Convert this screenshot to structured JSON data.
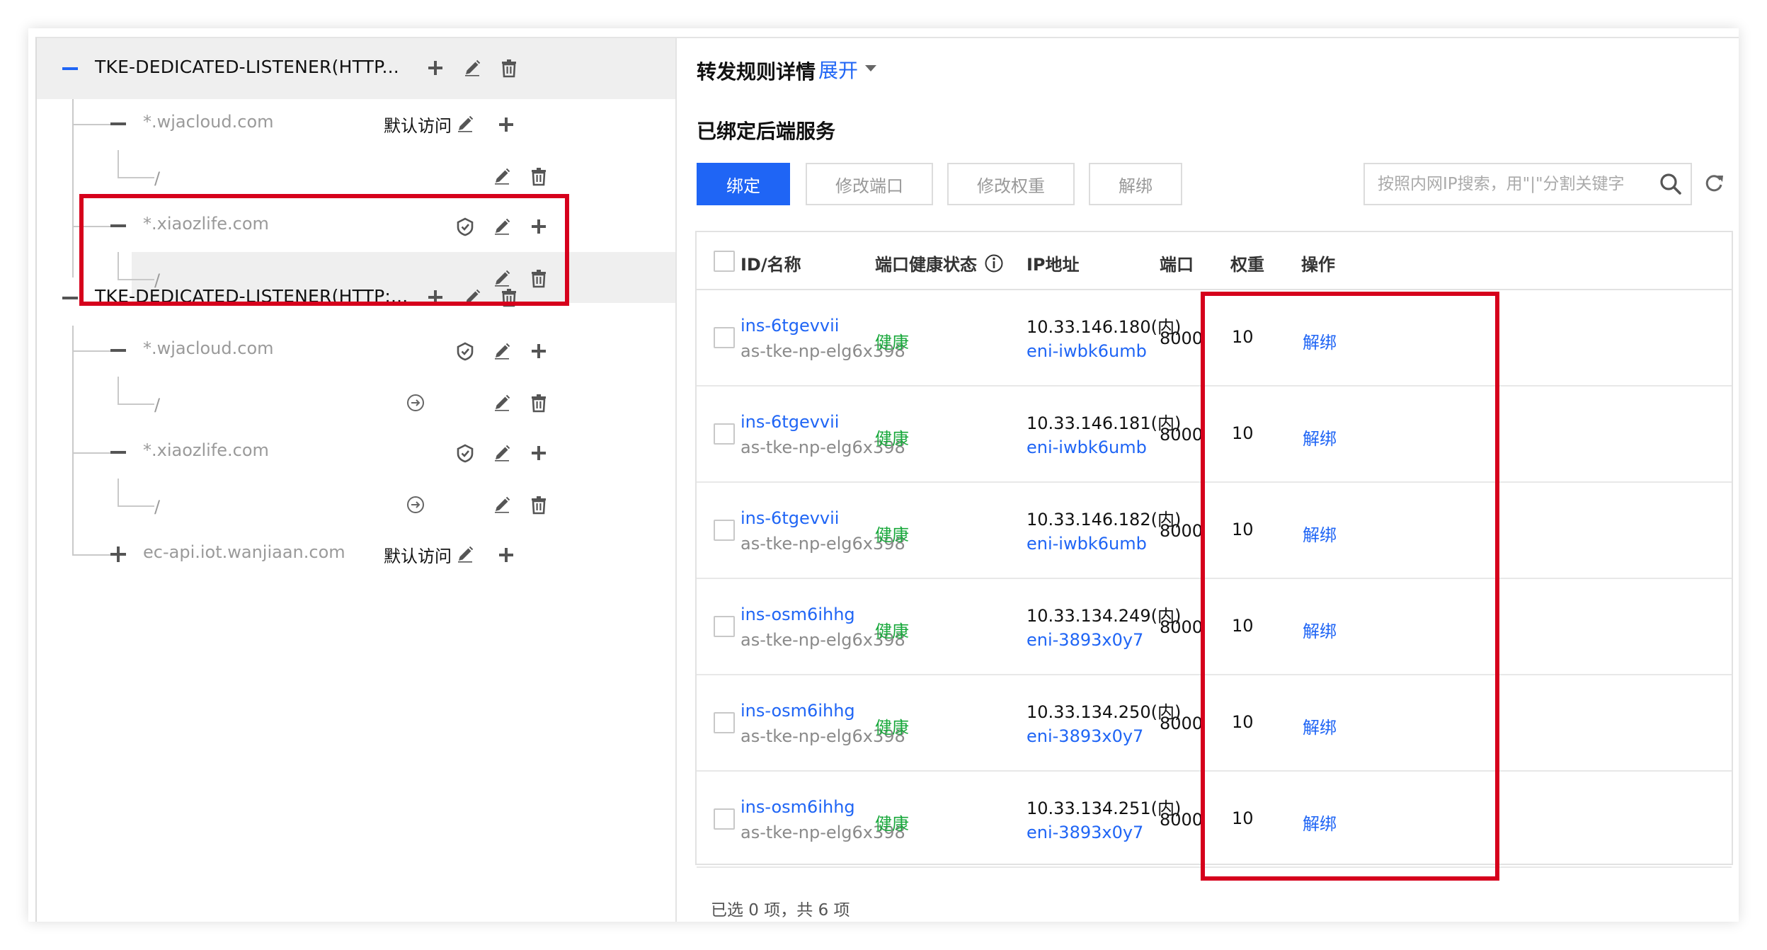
{
  "tree": {
    "listeners": [
      {
        "name": "TKE-DEDICATED-LISTENER(HTTP...",
        "expanded": true,
        "selected": true,
        "domains": [
          {
            "domain": "*.wjacloud.com",
            "default_label": "默认访问",
            "paths": [
              "/"
            ]
          },
          {
            "domain": "*.xiaozlife.com",
            "default_label": "",
            "paths": [
              "/"
            ]
          }
        ]
      },
      {
        "name": "TKE-DEDICATED-LISTENER(HTTP:...",
        "expanded": true,
        "selected": false,
        "domains": [
          {
            "domain": "*.wjacloud.com",
            "default_label": "",
            "paths": [
              "/"
            ]
          },
          {
            "domain": "*.xiaozlife.com",
            "default_label": "",
            "paths": [
              "/"
            ]
          },
          {
            "domain": "ec-api.iot.wanjiaan.com",
            "default_label": "默认访问",
            "paths": []
          }
        ]
      }
    ]
  },
  "detail": {
    "title": "转发规则详情",
    "expand_label": "展开",
    "section_title": "已绑定后端服务",
    "toolbar": {
      "bind": "绑定",
      "modify_port": "修改端口",
      "modify_weight": "修改权重",
      "unbind": "解绑"
    },
    "search": {
      "placeholder": "按照内网IP搜索，用\"|\"分割关键字",
      "value": ""
    },
    "columns": {
      "id_name": "ID/名称",
      "health": "端口健康状态",
      "ip": "IP地址",
      "port": "端口",
      "weight": "权重",
      "action": "操作"
    },
    "rows": [
      {
        "id": "ins-6tgevvii",
        "name": "as-tke-np-elg6x398",
        "health": "健康",
        "ip": "10.33.146.180(内)",
        "eni": "eni-iwbk6umb",
        "port": "8000",
        "weight": "10",
        "action": "解绑"
      },
      {
        "id": "ins-6tgevvii",
        "name": "as-tke-np-elg6x398",
        "health": "健康",
        "ip": "10.33.146.181(内)",
        "eni": "eni-iwbk6umb",
        "port": "8000",
        "weight": "10",
        "action": "解绑"
      },
      {
        "id": "ins-6tgevvii",
        "name": "as-tke-np-elg6x398",
        "health": "健康",
        "ip": "10.33.146.182(内)",
        "eni": "eni-iwbk6umb",
        "port": "8000",
        "weight": "10",
        "action": "解绑"
      },
      {
        "id": "ins-osm6ihhg",
        "name": "as-tke-np-elg6x398",
        "health": "健康",
        "ip": "10.33.134.249(内)",
        "eni": "eni-3893x0y7",
        "port": "8000",
        "weight": "10",
        "action": "解绑"
      },
      {
        "id": "ins-osm6ihhg",
        "name": "as-tke-np-elg6x398",
        "health": "健康",
        "ip": "10.33.134.250(内)",
        "eni": "eni-3893x0y7",
        "port": "8000",
        "weight": "10",
        "action": "解绑"
      },
      {
        "id": "ins-osm6ihhg",
        "name": "as-tke-np-elg6x398",
        "health": "健康",
        "ip": "10.33.134.251(内)",
        "eni": "eni-3893x0y7",
        "port": "8000",
        "weight": "10",
        "action": "解绑"
      }
    ],
    "footer": "已选 0 项，共 6 项"
  },
  "colors": {
    "accent": "#1f65f5",
    "healthy": "#18a83b",
    "highlight_box": "#d6001c"
  }
}
